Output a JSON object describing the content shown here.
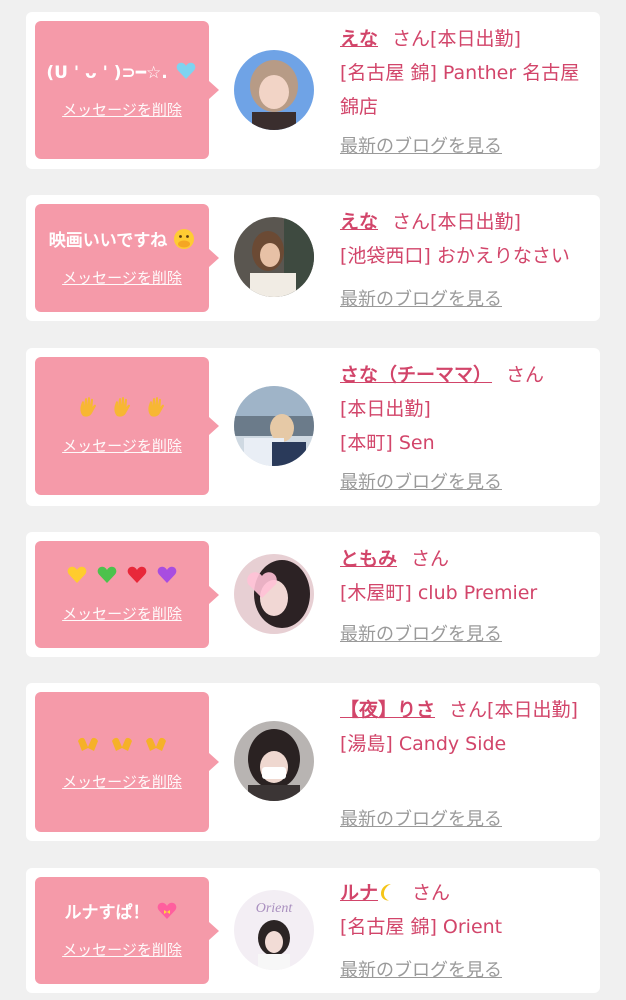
{
  "delete_label": "メッセージを削除",
  "blog_label": "最新のブログを見る",
  "san_label": "さん",
  "messages": [
    {
      "message_text": "(U ' ᴗ ' )⊃━☆.",
      "message_icon": "light-blue-heart-icon",
      "name": "えな",
      "status": "[本日出勤]",
      "shop": "[名古屋 錦] Panther 名古屋錦店"
    },
    {
      "message_text": "映画いいですね",
      "message_icon": "face-with-hand-over-mouth-icon",
      "name": "えな",
      "status": "[本日出勤]",
      "shop": "[池袋西口] おかえりなさい"
    },
    {
      "message_text": "",
      "message_icon": "raised-hands-icon",
      "name": "さな（チーママ）",
      "status": "[本日出勤]",
      "shop": "[本町] Sen"
    },
    {
      "message_text": "",
      "message_icon": "colored-hearts-icon",
      "name": "ともみ",
      "status": "",
      "shop": "[木屋町] club Premier"
    },
    {
      "message_text": "",
      "message_icon": "open-hands-icon",
      "name": "【夜】りさ",
      "status": "[本日出勤]",
      "shop": "[湯島] Candy Side"
    },
    {
      "message_text": "ルナすぱ！",
      "message_icon": "heart-with-ribbon-icon",
      "name": "ルナ",
      "name_icon": "crescent-moon-icon",
      "status": "",
      "shop": "[名古屋 錦] Orient",
      "avatar_text": "Orient"
    }
  ],
  "colors": {
    "bubble": "#f59aa9",
    "accent": "#d2456a",
    "link_gray": "#9a9a9a"
  }
}
